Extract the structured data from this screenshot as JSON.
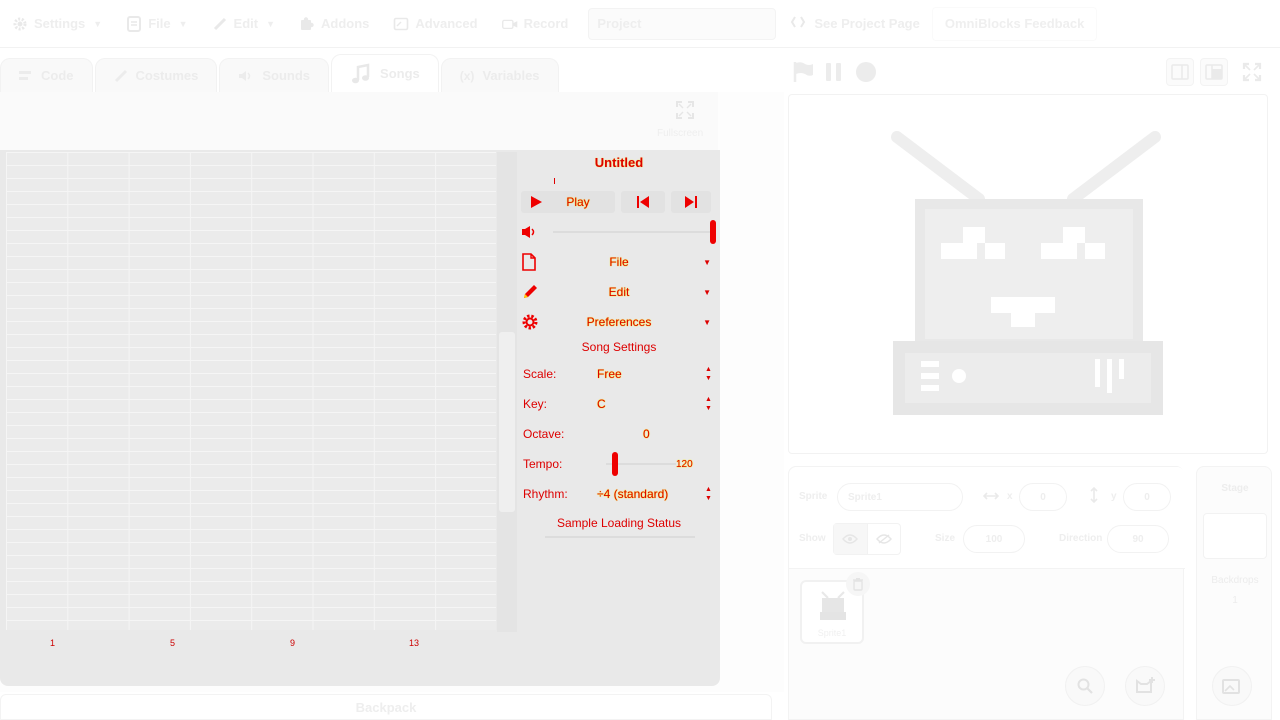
{
  "menubar": {
    "settings": "Settings",
    "file": "File",
    "edit": "Edit",
    "addons": "Addons",
    "advanced": "Advanced",
    "record": "Record",
    "project_title": "Project",
    "see_project_page": "See Project Page",
    "feedback": "OmniBlocks Feedback"
  },
  "tabs": [
    {
      "label": "Code",
      "icon": "code-icon"
    },
    {
      "label": "Costumes",
      "icon": "brush-icon"
    },
    {
      "label": "Sounds",
      "icon": "speaker-icon"
    },
    {
      "label": "Songs",
      "icon": "music-note-icon",
      "active": true
    },
    {
      "label": "Variables",
      "icon": "variable-icon"
    }
  ],
  "songs": {
    "fullscreen_label": "Fullscreen",
    "bar_numbers": [
      "1",
      "5",
      "9",
      "13"
    ],
    "panel": {
      "title": "Untitled",
      "play_label": "Play",
      "file_label": "File",
      "edit_label": "Edit",
      "preferences_label": "Preferences",
      "song_settings_label": "Song Settings",
      "scale_label": "Scale:",
      "scale_value": "Free",
      "key_label": "Key:",
      "key_value": "C",
      "octave_label": "Octave:",
      "octave_value": "0",
      "tempo_label": "Tempo:",
      "tempo_value": "120",
      "rhythm_label": "Rhythm:",
      "rhythm_value": "÷4 (standard)",
      "sample_loading_label": "Sample Loading Status"
    }
  },
  "backpack": "Backpack",
  "sprite_info": {
    "sprite_label": "Sprite",
    "sprite_name": "Sprite1",
    "x_label": "x",
    "x_value": "0",
    "y_label": "y",
    "y_value": "0",
    "show_label": "Show",
    "size_label": "Size",
    "size_value": "100",
    "direction_label": "Direction",
    "direction_value": "90"
  },
  "sprites": [
    {
      "name": "Sprite1"
    }
  ],
  "stage_pane": {
    "label": "Stage",
    "backdrops_label": "Backdrops",
    "backdrops_count": "1"
  },
  "colors": {
    "annotation_red": "#dd0000",
    "annotation_yellow": "#ffee00",
    "washed_ui": "#eeeeee"
  }
}
